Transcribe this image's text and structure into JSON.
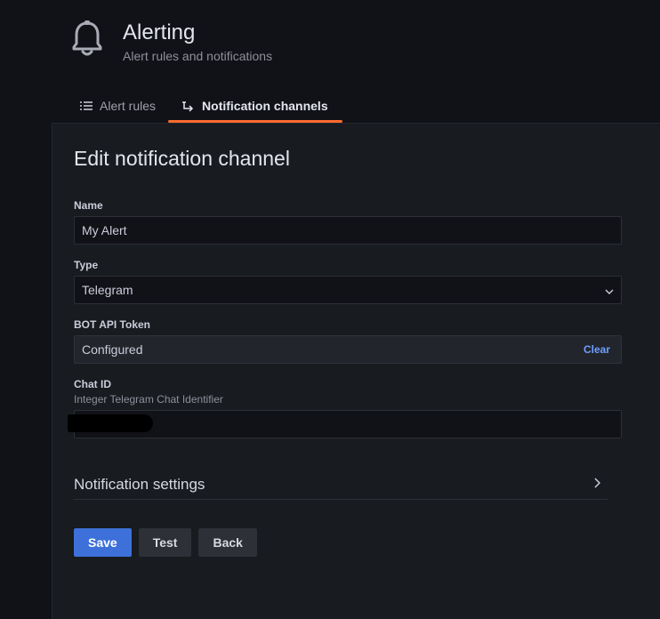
{
  "header": {
    "icon": "bell-icon",
    "title": "Alerting",
    "subtitle": "Alert rules and notifications"
  },
  "tabs": [
    {
      "label": "Alert rules",
      "icon": "list-icon",
      "active": false
    },
    {
      "label": "Notification channels",
      "icon": "channel-icon",
      "active": true
    }
  ],
  "form": {
    "title": "Edit notification channel",
    "name": {
      "label": "Name",
      "value": "My Alert"
    },
    "type": {
      "label": "Type",
      "value": "Telegram"
    },
    "bot_token": {
      "label": "BOT API Token",
      "value": "Configured",
      "clear_label": "Clear"
    },
    "chat_id": {
      "label": "Chat ID",
      "description": "Integer Telegram Chat Identifier"
    },
    "settings_label": "Notification settings"
  },
  "actions": {
    "save": "Save",
    "test": "Test",
    "back": "Back"
  },
  "colors": {
    "accent": "#ff6a2f",
    "primary_button": "#3d71d9",
    "link": "#6e9fff",
    "background": "#111217",
    "panel": "#181b1f"
  }
}
